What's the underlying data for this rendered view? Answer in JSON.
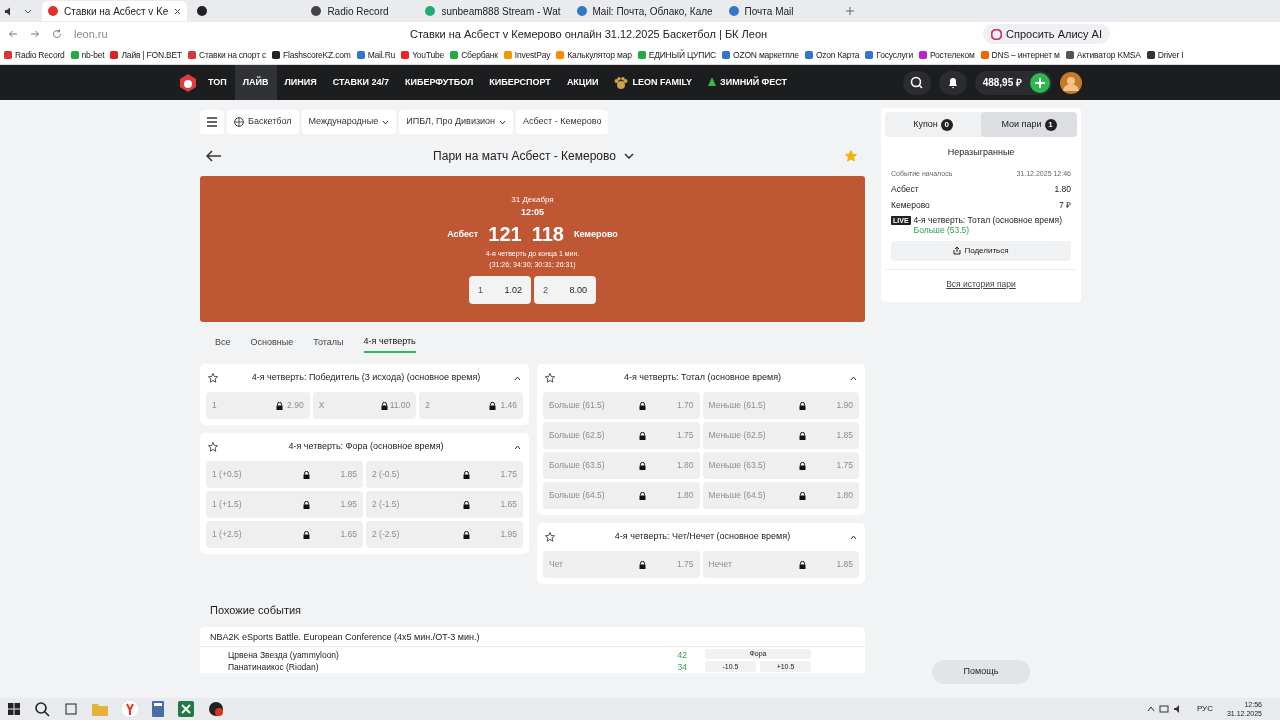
{
  "browser": {
    "tabs": [
      {
        "title": "Ставки на Асбест v Ke",
        "selected": true
      },
      {
        "selected": false
      },
      {
        "title": "Radio Record",
        "selected": false
      },
      {
        "title": "sunbeam888 Stream - Wat",
        "selected": false
      },
      {
        "title": "Mail: Почта, Облако, Кале",
        "selected": false
      },
      {
        "title": "Почта Mail",
        "selected": false
      }
    ],
    "address": "leon.ru",
    "page_title": "Ставки на Асбест v Кемерово онлайн 31.12.2025 Баскетбол | БК Леон",
    "alice": "Спросить Алису AI",
    "bookmarks": [
      "Radio Record",
      "nb-bet",
      "Лайв | FON.BET",
      "Ставки на спорт с",
      "FlashscoreKZ.com",
      "Mail.Ru",
      "YouTube",
      "Сбербанк",
      "InvestPay",
      "Калькулятор мар",
      "ЕДИНЫЙ ЦУПИС",
      "OZON маркетпле",
      "Ozon Карта",
      "Госуслуги",
      "Ростелеком",
      "DNS – интернет м",
      "Активатор KMSA",
      "Driver I"
    ]
  },
  "nav": [
    {
      "label": "ТОП",
      "selected": false
    },
    {
      "label": "ЛАЙВ",
      "selected": true
    },
    {
      "label": "ЛИНИЯ",
      "selected": false
    },
    {
      "label": "СТАВКИ 24/7",
      "selected": false
    },
    {
      "label": "КИБЕРФУТБОЛ",
      "selected": false
    },
    {
      "label": "КИБЕРСПОРТ",
      "selected": false
    },
    {
      "label": "АКЦИИ",
      "selected": false
    },
    {
      "label": "LEON FAMILY",
      "selected": false
    },
    {
      "label": "ЗИМНИЙ ФЕСТ",
      "selected": false
    }
  ],
  "balance": "488,95 ₽",
  "breadcrumbs": [
    "Баскетбол",
    "Международные",
    "ИПБЛ, Про Дивизион",
    "Асбест - Кемерово"
  ],
  "match": {
    "title": "Пари на матч Асбест - Кемерово",
    "favorite": true,
    "date": "31 Декабря",
    "time": "12:05",
    "home": "Асбест",
    "away": "Кемерово",
    "home_score": "121",
    "away_score": "118",
    "period": "4-я четверть до конца 1 мин.",
    "quarters": "(31:26; 34:30; 30:31; 26:31)",
    "odds": [
      {
        "label": "1",
        "value": "1.02"
      },
      {
        "label": "2",
        "value": "8.00"
      }
    ]
  },
  "market_tabs": [
    {
      "label": "Все",
      "selected": false
    },
    {
      "label": "Основные",
      "selected": false
    },
    {
      "label": "Тоталы",
      "selected": false
    },
    {
      "label": "4-я четверть",
      "selected": true
    }
  ],
  "market_columns": [
    {
      "markets": [
        {
          "title": "4-я четверть: Победитель (3 исхода) (основное время)",
          "outcomes": [
            {
              "label": "1",
              "odd": "2.90",
              "locked": true
            },
            {
              "label": "X",
              "odd": "11.00",
              "locked": true
            },
            {
              "label": "2",
              "odd": "1.46",
              "locked": true
            }
          ]
        },
        {
          "title": "4-я четверть: Фора (основное время)",
          "outcomes": [
            {
              "label": "1 (+0.5)",
              "odd": "1.85",
              "locked": true
            },
            {
              "label": "2 (-0.5)",
              "odd": "1.75",
              "locked": true
            },
            {
              "label": "1 (+1.5)",
              "odd": "1.95",
              "locked": true
            },
            {
              "label": "2 (-1.5)",
              "odd": "1.65",
              "locked": true
            },
            {
              "label": "1 (+2.5)",
              "odd": "1.65",
              "locked": true
            },
            {
              "label": "2 (-2.5)",
              "odd": "1.95",
              "locked": true
            }
          ]
        }
      ]
    },
    {
      "markets": [
        {
          "title": "4-я четверть: Тотал (основное время)",
          "outcomes": [
            {
              "label": "Больше (61.5)",
              "odd": "1.70",
              "locked": true
            },
            {
              "label": "Меньше (61.5)",
              "odd": "1.90",
              "locked": true
            },
            {
              "label": "Больше (62.5)",
              "odd": "1.75",
              "locked": true
            },
            {
              "label": "Меньше (62.5)",
              "odd": "1.85",
              "locked": true
            },
            {
              "label": "Больше (63.5)",
              "odd": "1.80",
              "locked": true
            },
            {
              "label": "Меньше (63.5)",
              "odd": "1.75",
              "locked": true
            },
            {
              "label": "Больше (64.5)",
              "odd": "1.80",
              "locked": true
            },
            {
              "label": "Меньше (64.5)",
              "odd": "1.80",
              "locked": true
            }
          ]
        },
        {
          "title": "4-я четверть: Чет/Нечет (основное время)",
          "outcomes": [
            {
              "label": "Чет",
              "odd": "1.75",
              "locked": true
            },
            {
              "label": "Нечет",
              "odd": "1.85",
              "locked": true
            }
          ]
        }
      ]
    }
  ],
  "coupon": {
    "tabs": [
      {
        "label": "Купон",
        "count": "0",
        "selected": false
      },
      {
        "label": "Мои пари",
        "count": "1",
        "selected": true
      }
    ],
    "section": "Неразыгранные",
    "started_label": "Событие началось",
    "started_time": "31.12.2025 12:46",
    "home": "Асбест",
    "odd": "1.80",
    "away": "Кемерово",
    "stake": "7 ₽",
    "live": "LIVE",
    "bet": "4-я четверть: Тотал (основное время)",
    "selection": "Больше (53.5)",
    "share": "Поделиться",
    "history": "Вся история пари"
  },
  "similar": {
    "title": "Похожие события",
    "league": "NBA2K eSports Battle. European Conference (4x5 мин./OT-3 мин.)",
    "teams": [
      {
        "name": "Црвена Звезда (yammyloon)",
        "score": "42"
      },
      {
        "name": "Панатинаикос (Riodan)",
        "score": "34"
      }
    ],
    "market": "Фора",
    "odds": [
      "-10.5",
      "+10.5"
    ]
  },
  "help": "Помощь",
  "taskbar": {
    "lang": "РУС",
    "time": "12:56",
    "date": "31.12.2025"
  }
}
